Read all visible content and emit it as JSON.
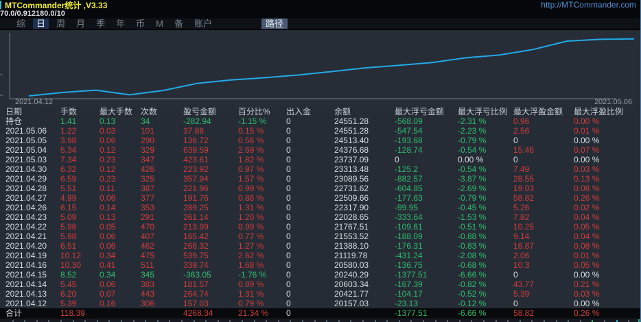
{
  "titlebar": {
    "title": "MTCommander统计 ,V3.33",
    "link": "http://MTCommander.com"
  },
  "subtitle": "70.0/0.912180.0/10",
  "menubar": {
    "items": [
      "综",
      "日",
      "周",
      "月",
      "季",
      "年",
      "币",
      "M",
      "备",
      "账户"
    ],
    "active_index": 1,
    "path_button": "路径"
  },
  "colors": {
    "red": "#d33c3c",
    "green": "#2fbd6e",
    "white": "#d9dde3",
    "line": "#22aae8",
    "axis": "#707a86",
    "tick": "#555f6b",
    "tick_green": "#2fae5e",
    "tick_cyan": "#2aa7c9"
  },
  "chart_data": {
    "type": "line",
    "title": "",
    "xlabel": "",
    "ylabel": "",
    "grid": false,
    "legend": false,
    "start_label": "2021.04.12",
    "end_label": "2021.05.06",
    "ylim": [
      20000,
      24800
    ],
    "x": [
      "2021.04.12",
      "2021.04.13",
      "2021.04.14",
      "2021.04.15",
      "2021.04.16",
      "2021.04.19",
      "2021.04.20",
      "2021.04.21",
      "2021.04.22",
      "2021.04.23",
      "2021.04.26",
      "2021.04.27",
      "2021.04.28",
      "2021.04.29",
      "2021.04.30",
      "2021.05.03",
      "2021.05.04",
      "2021.05.05",
      "2021.05.06"
    ],
    "series": [
      {
        "name": "余额",
        "values": [
          20157.03,
          20421.77,
          20603.34,
          20240.29,
          20580.03,
          21119.78,
          21388.1,
          21553.52,
          21767.51,
          22028.65,
          22317.9,
          22509.66,
          22731.62,
          23089.56,
          23313.48,
          23737.09,
          24376.68,
          24513.4,
          24551.28
        ]
      }
    ]
  },
  "table": {
    "headers": [
      "日期",
      "手数",
      "最大手数",
      "次数",
      "盈亏金额",
      "百分比%",
      "出入金",
      "余额",
      "最大浮亏金额",
      "最大浮亏比例",
      "最大浮盈金额",
      "最大浮盈比例"
    ],
    "rows": [
      {
        "name": "position",
        "cells": [
          [
            "持仓",
            "w"
          ],
          [
            "1.41",
            "g"
          ],
          [
            "0.13",
            "g"
          ],
          [
            "34",
            "g"
          ],
          [
            "-282.94",
            "g"
          ],
          [
            "-1.15 %",
            "g"
          ],
          [
            "0",
            "w"
          ],
          [
            "24551.28",
            "w"
          ],
          [
            "-568.09",
            "g"
          ],
          [
            "-2.31 %",
            "g"
          ],
          [
            "0.96",
            "r"
          ],
          [
            "0.00 %",
            "r"
          ]
        ]
      },
      {
        "name": "day",
        "cells": [
          [
            "2021.05.06",
            "w"
          ],
          [
            "1.22",
            "r"
          ],
          [
            "0.03",
            "r"
          ],
          [
            "101",
            "r"
          ],
          [
            "37.88",
            "r"
          ],
          [
            "0.15 %",
            "r"
          ],
          [
            "0",
            "w"
          ],
          [
            "24551.28",
            "w"
          ],
          [
            "-547.54",
            "g"
          ],
          [
            "-2.23 %",
            "g"
          ],
          [
            "2.56",
            "r"
          ],
          [
            "0.01 %",
            "r"
          ]
        ]
      },
      {
        "name": "day",
        "cells": [
          [
            "2021.05.05",
            "w"
          ],
          [
            "3.98",
            "r"
          ],
          [
            "0.06",
            "r"
          ],
          [
            "290",
            "r"
          ],
          [
            "136.72",
            "r"
          ],
          [
            "0.56 %",
            "r"
          ],
          [
            "0",
            "w"
          ],
          [
            "24513.40",
            "w"
          ],
          [
            "-193.68",
            "g"
          ],
          [
            "-0.79 %",
            "g"
          ],
          [
            "0",
            "w"
          ],
          [
            "0.00 %",
            "w"
          ]
        ]
      },
      {
        "name": "day",
        "cells": [
          [
            "2021.05.04",
            "w"
          ],
          [
            "5.34",
            "r"
          ],
          [
            "0.12",
            "r"
          ],
          [
            "329",
            "r"
          ],
          [
            "639.59",
            "r"
          ],
          [
            "2.69 %",
            "r"
          ],
          [
            "0",
            "w"
          ],
          [
            "24376.68",
            "w"
          ],
          [
            "-128.74",
            "g"
          ],
          [
            "-0.54 %",
            "g"
          ],
          [
            "15.46",
            "r"
          ],
          [
            "0.07 %",
            "r"
          ]
        ]
      },
      {
        "name": "day",
        "cells": [
          [
            "2021.05.03",
            "w"
          ],
          [
            "7.34",
            "r"
          ],
          [
            "0.23",
            "r"
          ],
          [
            "347",
            "r"
          ],
          [
            "423.61",
            "r"
          ],
          [
            "1.82 %",
            "r"
          ],
          [
            "0",
            "w"
          ],
          [
            "23737.09",
            "w"
          ],
          [
            "0",
            "w"
          ],
          [
            "0.00 %",
            "w"
          ],
          [
            "0",
            "w"
          ],
          [
            "0.00 %",
            "w"
          ]
        ]
      },
      {
        "name": "day",
        "cells": [
          [
            "2021.04.30",
            "w"
          ],
          [
            "6.32",
            "r"
          ],
          [
            "0.12",
            "r"
          ],
          [
            "426",
            "r"
          ],
          [
            "223.92",
            "r"
          ],
          [
            "0.97 %",
            "r"
          ],
          [
            "0",
            "w"
          ],
          [
            "23313.48",
            "w"
          ],
          [
            "-125.2",
            "g"
          ],
          [
            "-0.54 %",
            "g"
          ],
          [
            "7.49",
            "r"
          ],
          [
            "0.03 %",
            "r"
          ]
        ]
      },
      {
        "name": "day",
        "cells": [
          [
            "2021.04.29",
            "w"
          ],
          [
            "6.59",
            "r"
          ],
          [
            "0.23",
            "r"
          ],
          [
            "325",
            "r"
          ],
          [
            "357.94",
            "r"
          ],
          [
            "1.57 %",
            "r"
          ],
          [
            "0",
            "w"
          ],
          [
            "23089.56",
            "w"
          ],
          [
            "-882.57",
            "g"
          ],
          [
            "-3.87 %",
            "g"
          ],
          [
            "28.55",
            "r"
          ],
          [
            "0.13 %",
            "r"
          ]
        ]
      },
      {
        "name": "day",
        "cells": [
          [
            "2021.04.28",
            "w"
          ],
          [
            "5.51",
            "r"
          ],
          [
            "0.11",
            "r"
          ],
          [
            "387",
            "r"
          ],
          [
            "221.96",
            "r"
          ],
          [
            "0.99 %",
            "r"
          ],
          [
            "0",
            "w"
          ],
          [
            "22731.62",
            "w"
          ],
          [
            "-604.85",
            "g"
          ],
          [
            "-2.69 %",
            "g"
          ],
          [
            "19.03",
            "r"
          ],
          [
            "0.08 %",
            "r"
          ]
        ]
      },
      {
        "name": "day",
        "cells": [
          [
            "2021.04.27",
            "w"
          ],
          [
            "4.99",
            "r"
          ],
          [
            "0.06",
            "r"
          ],
          [
            "377",
            "r"
          ],
          [
            "191.76",
            "r"
          ],
          [
            "0.86 %",
            "r"
          ],
          [
            "0",
            "w"
          ],
          [
            "22509.66",
            "w"
          ],
          [
            "-177.63",
            "g"
          ],
          [
            "-0.79 %",
            "g"
          ],
          [
            "58.82",
            "r"
          ],
          [
            "0.26 %",
            "r"
          ]
        ]
      },
      {
        "name": "day",
        "cells": [
          [
            "2021.04.26",
            "w"
          ],
          [
            "6.15",
            "r"
          ],
          [
            "0.14",
            "r"
          ],
          [
            "353",
            "r"
          ],
          [
            "289.25",
            "r"
          ],
          [
            "1.31 %",
            "r"
          ],
          [
            "0",
            "w"
          ],
          [
            "22317.90",
            "w"
          ],
          [
            "-99.95",
            "g"
          ],
          [
            "-0.45 %",
            "g"
          ],
          [
            "5.26",
            "r"
          ],
          [
            "0.02 %",
            "r"
          ]
        ]
      },
      {
        "name": "day",
        "cells": [
          [
            "2021.04.23",
            "w"
          ],
          [
            "5.09",
            "r"
          ],
          [
            "0.13",
            "r"
          ],
          [
            "291",
            "r"
          ],
          [
            "261.14",
            "r"
          ],
          [
            "1.20 %",
            "r"
          ],
          [
            "0",
            "w"
          ],
          [
            "22028.65",
            "w"
          ],
          [
            "-333.64",
            "g"
          ],
          [
            "-1.53 %",
            "g"
          ],
          [
            "7.82",
            "r"
          ],
          [
            "0.04 %",
            "r"
          ]
        ]
      },
      {
        "name": "day",
        "cells": [
          [
            "2021.04.22",
            "w"
          ],
          [
            "5.98",
            "r"
          ],
          [
            "0.05",
            "r"
          ],
          [
            "470",
            "r"
          ],
          [
            "213.99",
            "r"
          ],
          [
            "0.99 %",
            "r"
          ],
          [
            "0",
            "w"
          ],
          [
            "21767.51",
            "w"
          ],
          [
            "-109.61",
            "g"
          ],
          [
            "-0.51 %",
            "g"
          ],
          [
            "10.25",
            "r"
          ],
          [
            "0.05 %",
            "r"
          ]
        ]
      },
      {
        "name": "day",
        "cells": [
          [
            "2021.04.21",
            "w"
          ],
          [
            "5.98",
            "r"
          ],
          [
            "0.06",
            "r"
          ],
          [
            "407",
            "r"
          ],
          [
            "165.42",
            "r"
          ],
          [
            "0.77 %",
            "r"
          ],
          [
            "0",
            "w"
          ],
          [
            "21553.52",
            "w"
          ],
          [
            "-188.09",
            "g"
          ],
          [
            "-0.88 %",
            "g"
          ],
          [
            "9.14",
            "r"
          ],
          [
            "0.04 %",
            "r"
          ]
        ]
      },
      {
        "name": "day",
        "cells": [
          [
            "2021.04.20",
            "w"
          ],
          [
            "6.51",
            "r"
          ],
          [
            "0.06",
            "r"
          ],
          [
            "462",
            "r"
          ],
          [
            "268.32",
            "r"
          ],
          [
            "1.27 %",
            "r"
          ],
          [
            "0",
            "w"
          ],
          [
            "21388.10",
            "w"
          ],
          [
            "-176.31",
            "g"
          ],
          [
            "-0.83 %",
            "g"
          ],
          [
            "16.87",
            "r"
          ],
          [
            "0.08 %",
            "r"
          ]
        ]
      },
      {
        "name": "day",
        "cells": [
          [
            "2021.04.19",
            "w"
          ],
          [
            "10.12",
            "r"
          ],
          [
            "0.34",
            "r"
          ],
          [
            "475",
            "r"
          ],
          [
            "539.75",
            "r"
          ],
          [
            "2.62 %",
            "r"
          ],
          [
            "0",
            "w"
          ],
          [
            "21119.78",
            "w"
          ],
          [
            "-431.24",
            "g"
          ],
          [
            "-2.08 %",
            "g"
          ],
          [
            "2.06",
            "r"
          ],
          [
            "0.01 %",
            "r"
          ]
        ]
      },
      {
        "name": "day",
        "cells": [
          [
            "2021.04.16",
            "w"
          ],
          [
            "10.30",
            "r"
          ],
          [
            "0.41",
            "r"
          ],
          [
            "511",
            "r"
          ],
          [
            "339.74",
            "r"
          ],
          [
            "1.68 %",
            "r"
          ],
          [
            "0",
            "w"
          ],
          [
            "20580.03",
            "w"
          ],
          [
            "-136.75",
            "g"
          ],
          [
            "-0.68 %",
            "g"
          ],
          [
            "10.3",
            "r"
          ],
          [
            "0.05 %",
            "r"
          ]
        ]
      },
      {
        "name": "day",
        "cells": [
          [
            "2021.04.15",
            "w"
          ],
          [
            "8.52",
            "g"
          ],
          [
            "0.34",
            "g"
          ],
          [
            "345",
            "g"
          ],
          [
            "-363.05",
            "g"
          ],
          [
            "-1.76 %",
            "g"
          ],
          [
            "0",
            "w"
          ],
          [
            "20240.29",
            "w"
          ],
          [
            "-1377.51",
            "g"
          ],
          [
            "-6.66 %",
            "g"
          ],
          [
            "0",
            "w"
          ],
          [
            "0.00 %",
            "w"
          ]
        ]
      },
      {
        "name": "day",
        "cells": [
          [
            "2021.04.14",
            "w"
          ],
          [
            "5.45",
            "r"
          ],
          [
            "0.06",
            "r"
          ],
          [
            "383",
            "r"
          ],
          [
            "181.57",
            "r"
          ],
          [
            "0.89 %",
            "r"
          ],
          [
            "0",
            "w"
          ],
          [
            "20603.34",
            "w"
          ],
          [
            "-167.39",
            "g"
          ],
          [
            "-0.82 %",
            "g"
          ],
          [
            "43.77",
            "r"
          ],
          [
            "0.21 %",
            "r"
          ]
        ]
      },
      {
        "name": "day",
        "cells": [
          [
            "2021.04.13",
            "w"
          ],
          [
            "6.20",
            "r"
          ],
          [
            "0.07",
            "r"
          ],
          [
            "443",
            "r"
          ],
          [
            "264.74",
            "r"
          ],
          [
            "1.31 %",
            "r"
          ],
          [
            "0",
            "w"
          ],
          [
            "20421.77",
            "w"
          ],
          [
            "-104.17",
            "g"
          ],
          [
            "-0.52 %",
            "g"
          ],
          [
            "5.39",
            "r"
          ],
          [
            "0.03 %",
            "r"
          ]
        ]
      },
      {
        "name": "day",
        "cells": [
          [
            "2021.04.12",
            "w"
          ],
          [
            "5.39",
            "r"
          ],
          [
            "0.16",
            "r"
          ],
          [
            "306",
            "r"
          ],
          [
            "157.03",
            "r"
          ],
          [
            "0.79 %",
            "r"
          ],
          [
            "0",
            "w"
          ],
          [
            "20157.03",
            "w"
          ],
          [
            "-23.13",
            "g"
          ],
          [
            "-0.12 %",
            "g"
          ],
          [
            "0",
            "w"
          ],
          [
            "0.00 %",
            "w"
          ]
        ]
      },
      {
        "name": "total",
        "total": true,
        "cells": [
          [
            "合计",
            "w"
          ],
          [
            "118.39",
            "r"
          ],
          [
            "",
            ""
          ],
          [
            "",
            ""
          ],
          [
            "4268.34",
            "r"
          ],
          [
            "21.34 %",
            "r"
          ],
          [
            "0",
            "w"
          ],
          [
            "",
            ""
          ],
          [
            "-1377.51",
            "g"
          ],
          [
            "-6.66 %",
            "g"
          ],
          [
            "58.82",
            "r"
          ],
          [
            "0.26 %",
            "r"
          ]
        ]
      }
    ]
  }
}
